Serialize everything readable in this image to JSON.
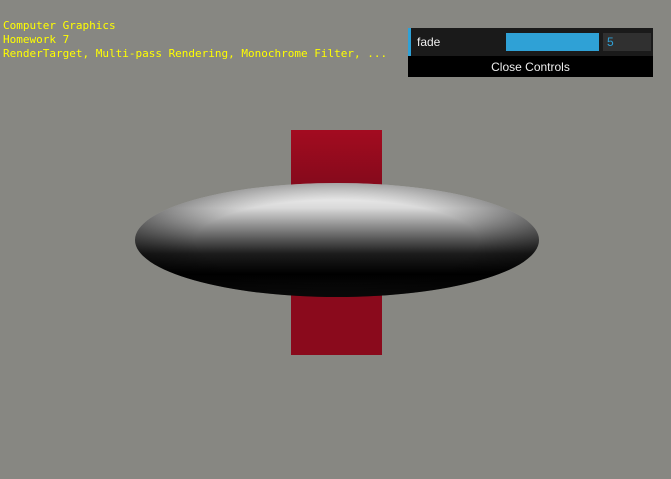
{
  "info": {
    "line1": "Computer Graphics",
    "line2": "Homework 7",
    "line3": "RenderTarget, Multi-pass Rendering, Monochrome Filter, ..."
  },
  "gui": {
    "param_label": "fade",
    "param_value": "5",
    "slider_fraction": 1.0,
    "close_label": "Close Controls",
    "accent_color": "#2fa1d6"
  },
  "scene": {
    "background_color": "#878782",
    "plane_color": "#a30b20",
    "torus_colors": [
      "#ffffff",
      "#000000"
    ]
  }
}
